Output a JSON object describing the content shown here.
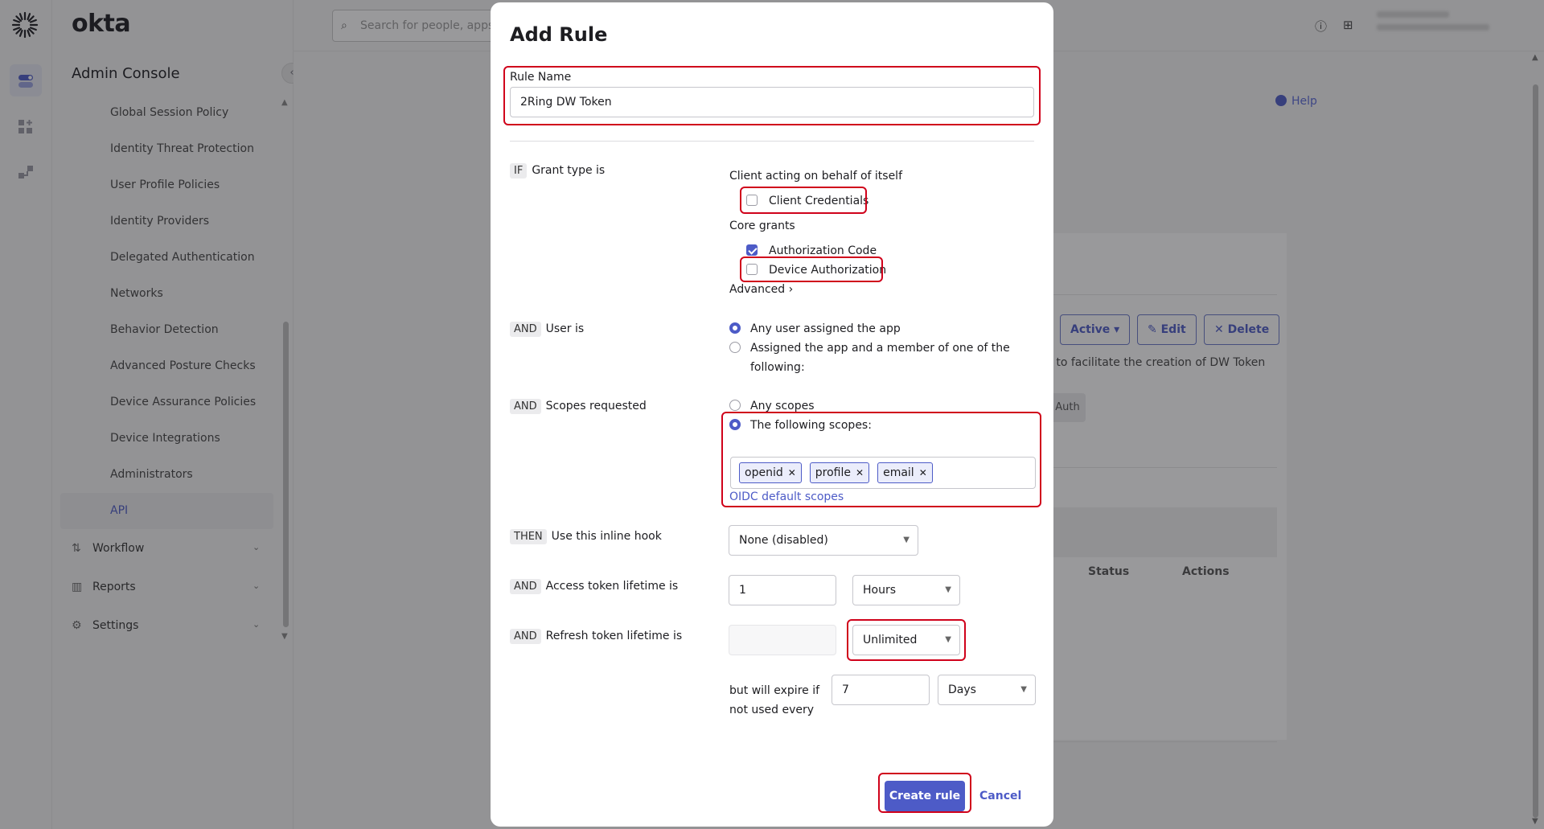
{
  "brand": "okta",
  "sidebar": {
    "title": "Admin Console",
    "items": [
      {
        "label": "Global Session Policy"
      },
      {
        "label": "Identity Threat Protection"
      },
      {
        "label": "User Profile Policies"
      },
      {
        "label": "Identity Providers"
      },
      {
        "label": "Delegated Authentication"
      },
      {
        "label": "Networks"
      },
      {
        "label": "Behavior Detection"
      },
      {
        "label": "Advanced Posture Checks"
      },
      {
        "label": "Device Assurance Policies"
      },
      {
        "label": "Device Integrations"
      },
      {
        "label": "Administrators"
      },
      {
        "label": "API",
        "selected": true
      }
    ],
    "groups": [
      {
        "label": "Workflow",
        "icon": "workflow-icon"
      },
      {
        "label": "Reports",
        "icon": "reports-icon"
      },
      {
        "label": "Settings",
        "icon": "settings-gear-icon"
      }
    ]
  },
  "topbar": {
    "search_placeholder": "Search for people, apps"
  },
  "background": {
    "help": "Help",
    "buttons": {
      "active": "Active",
      "edit": "Edit",
      "delete": "Delete"
    },
    "description_fragment": "d to facilitate the creation of DW Token",
    "pill": "Auth",
    "table_headers": {
      "status": "Status",
      "actions": "Actions"
    }
  },
  "modal": {
    "title": "Add Rule",
    "rule_name": {
      "label": "Rule Name",
      "value": "2Ring DW Token"
    },
    "grant": {
      "tag": "IF",
      "label": "Grant type is",
      "self_heading": "Client acting on behalf of itself",
      "client_credentials": {
        "label": "Client Credentials",
        "checked": false
      },
      "core_heading": "Core grants",
      "authorization_code": {
        "label": "Authorization Code",
        "checked": true
      },
      "device_authorization": {
        "label": "Device Authorization",
        "checked": false
      },
      "advanced": "Advanced"
    },
    "user": {
      "tag": "AND",
      "label": "User is",
      "option_any": "Any user assigned the app",
      "option_member_line1": "Assigned the app and a member of one of the",
      "option_member_line2": "following:",
      "selected": "any"
    },
    "scopes": {
      "tag": "AND",
      "label": "Scopes requested",
      "option_any": "Any scopes",
      "option_following": "The following scopes:",
      "selected": "following",
      "chips": [
        "openid",
        "profile",
        "email"
      ],
      "default_link": "OIDC default scopes"
    },
    "hook": {
      "tag": "THEN",
      "label": "Use this inline hook",
      "value": "None (disabled)"
    },
    "access": {
      "tag": "AND",
      "label": "Access token lifetime is",
      "value": "1",
      "unit": "Hours"
    },
    "refresh": {
      "tag": "AND",
      "label": "Refresh token lifetime is",
      "value": "",
      "unit": "Unlimited",
      "expire_line1": "but will expire if",
      "expire_line2": "not used every",
      "expire_value": "7",
      "expire_unit": "Days"
    },
    "actions": {
      "create": "Create rule",
      "cancel": "Cancel"
    }
  },
  "colors": {
    "accent": "#4d5bc7",
    "highlight": "#d0021b"
  }
}
